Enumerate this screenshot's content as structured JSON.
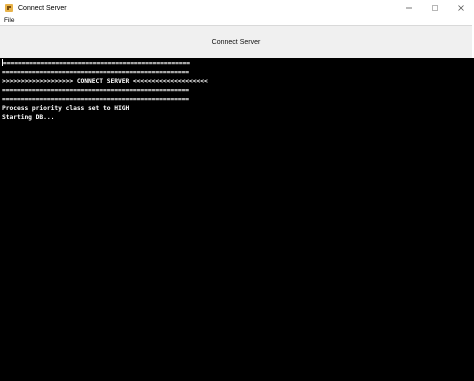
{
  "window": {
    "title": "Connect Server",
    "controls": {
      "minimize": "minimize-icon",
      "maximize": "maximize-icon",
      "close": "close-icon"
    }
  },
  "menubar": {
    "items": [
      {
        "label": "File"
      }
    ]
  },
  "header": {
    "title": "Connect Server"
  },
  "console": {
    "lines": [
      "==================================================",
      "==================================================",
      ">>>>>>>>>>>>>>>>>>> CONNECT SERVER <<<<<<<<<<<<<<<<<<<<",
      "==================================================",
      "==================================================",
      "Process priority class set to HIGH",
      "Starting DB..."
    ]
  },
  "colors": {
    "console_bg": "#000000",
    "console_text": "#ffffff",
    "header_bg": "#f0f0f0"
  }
}
